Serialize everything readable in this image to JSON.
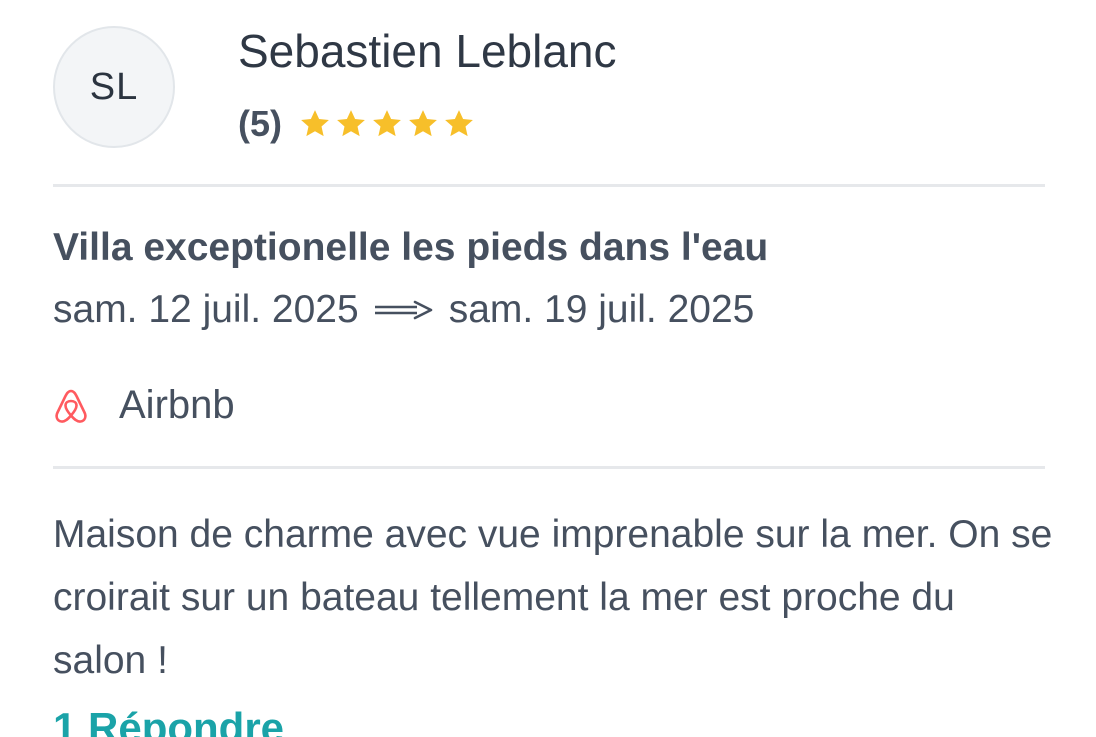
{
  "reviewer": {
    "initials": "SL",
    "name": "Sebastien Leblanc",
    "rating_count": "(5)",
    "rating_value": 5,
    "rating_max": 5,
    "star_color": "#F7BF2A"
  },
  "listing": {
    "title": "Villa exceptionelle les pieds dans l'eau",
    "date_start": "sam. 12 juil. 2025",
    "date_end": "sam. 19 juil. 2025",
    "arrow_icon": "long-right-arrow-icon"
  },
  "source": {
    "icon": "airbnb-icon",
    "icon_color": "#FF5A5F",
    "label": "Airbnb"
  },
  "review": {
    "text": "Maison de charme avec vue imprenable sur la mer. On se croirait sur un bateau tellement la mer est proche du salon !"
  },
  "reply": {
    "label": "1 Répondre",
    "color": "#1AA3A8"
  }
}
